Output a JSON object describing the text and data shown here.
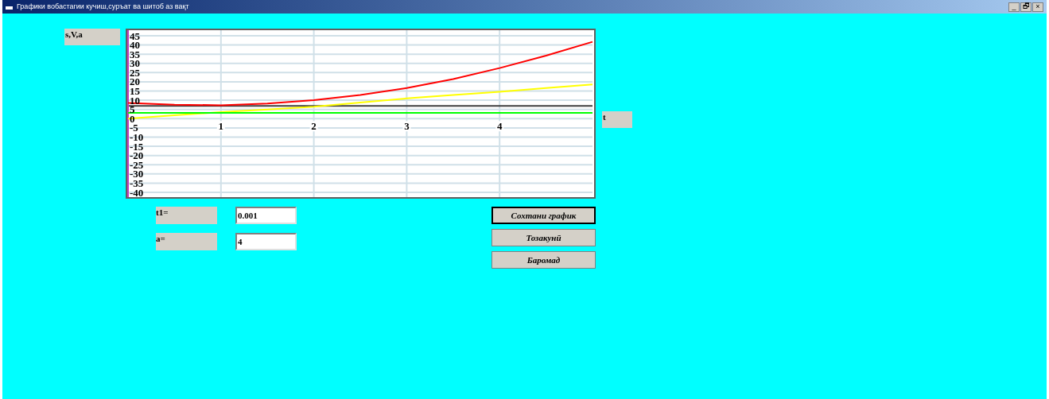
{
  "window": {
    "title": "Графики вобастагии  кучиш,суръат ва шитоб аз вақт",
    "controls": [
      "_",
      "🗗",
      "×"
    ]
  },
  "y_label": "s,V,a",
  "x_label": "t",
  "chart_data": {
    "type": "line",
    "x": [
      0,
      0.5,
      1,
      1.5,
      2,
      2.5,
      3,
      3.5,
      4,
      4.5,
      5
    ],
    "xlim": [
      0,
      5
    ],
    "ylim": [
      -40,
      45
    ],
    "xticks": [
      1,
      2,
      3,
      4
    ],
    "grid": true,
    "yticks": [
      45,
      40,
      35,
      30,
      25,
      20,
      15,
      10,
      5,
      0,
      -5,
      -10,
      -15,
      -20,
      -25,
      -30,
      -35,
      -40
    ],
    "series": [
      {
        "color": "#ff0000",
        "values": [
          8.5,
          7.6,
          7.3,
          8.2,
          10,
          12.8,
          16.6,
          21.5,
          27.5,
          34.2,
          41.7
        ]
      },
      {
        "color": "#ffff00",
        "values": [
          0,
          1.8,
          3.6,
          5,
          6.5,
          8.7,
          11,
          12.8,
          14.6,
          16.6,
          18.6
        ]
      },
      {
        "color": "#00ff00",
        "values": [
          3.2,
          3.2,
          3.2,
          3.2,
          3.2,
          3.2,
          3.2,
          3.2,
          3.2,
          3.2,
          3.2
        ]
      }
    ]
  },
  "fields": [
    {
      "label": "t1=",
      "value": "0.001"
    },
    {
      "label": "a=",
      "value": "4"
    }
  ],
  "buttons": [
    {
      "label": "Сохтани график",
      "selected": true
    },
    {
      "label": "Тозакунӣ",
      "selected": false
    },
    {
      "label": "Баромад",
      "selected": false
    }
  ]
}
